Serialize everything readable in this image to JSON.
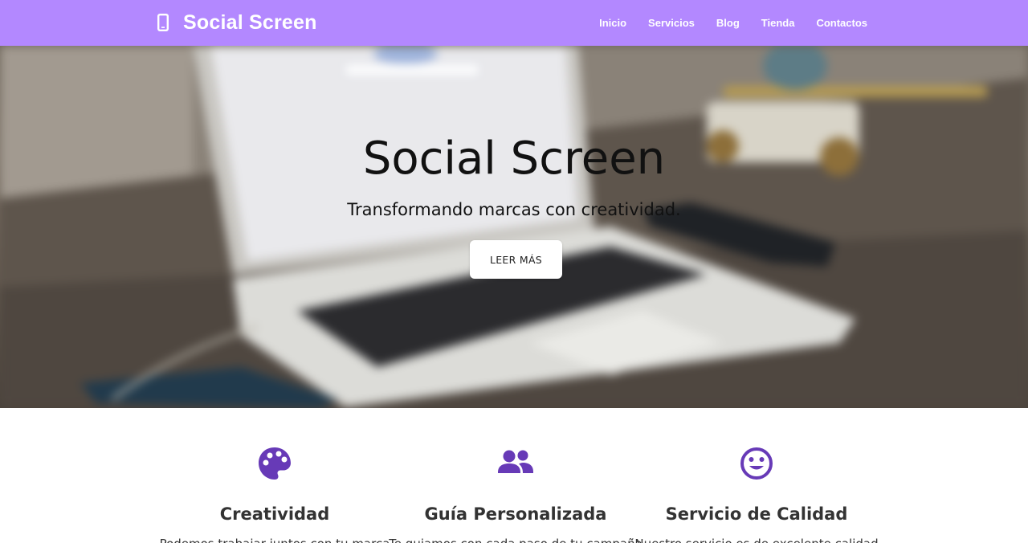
{
  "navbar": {
    "brand": "Social Screen",
    "brand_icon": "mobile-phone-icon",
    "links": [
      "Inicio",
      "Servicios",
      "Blog",
      "Tienda",
      "Contactos"
    ],
    "background": "#b388ff"
  },
  "hero": {
    "title": "Social Screen",
    "subtitle": "Transformando marcas con creatividad.",
    "button_label": "LEER MÁS"
  },
  "features": [
    {
      "icon": "palette-icon",
      "title": "Creatividad",
      "text": "Podemos trabajar juntos con tu marca"
    },
    {
      "icon": "users-icon",
      "title": "Guía Personalizada",
      "text": "Te guiamos con cada paso de tu campaña"
    },
    {
      "icon": "smile-icon",
      "title": "Servicio de Calidad",
      "text": "Nuestro servicio es de excelente calidad"
    }
  ],
  "colors": {
    "accent": "#673ab7",
    "nav": "#b388ff"
  }
}
